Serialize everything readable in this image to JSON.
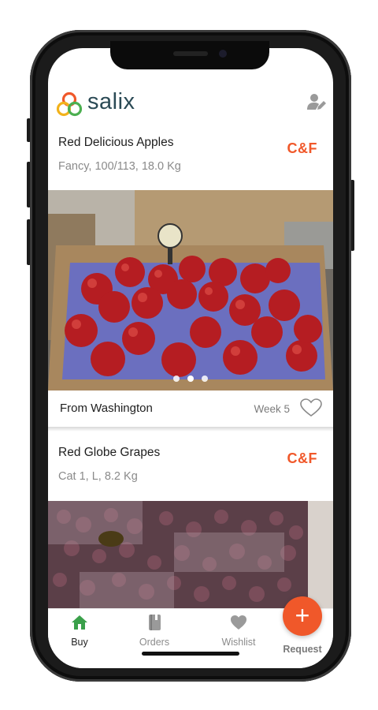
{
  "app": {
    "brand": "salix"
  },
  "colors": {
    "accent": "#f0582a",
    "brand_text": "#2b4a55",
    "active_tab": "#3aa04a"
  },
  "products": [
    {
      "title": "Red Delicious Apples",
      "details": "Fancy, 100/113, 18.0 Kg",
      "badge": "C&F",
      "origin": "From Washington",
      "week": "Week 5",
      "photo_icon": "apples-photo",
      "carousel": {
        "count": 3,
        "active": 1
      }
    },
    {
      "title": "Red Globe Grapes",
      "details": "Cat 1, L, 8.2 Kg",
      "badge": "C&F",
      "photo_icon": "grapes-photo"
    }
  ],
  "tabs": [
    {
      "label": "Buy",
      "icon": "home-icon",
      "active": true
    },
    {
      "label": "Orders",
      "icon": "book-icon",
      "active": false
    },
    {
      "label": "Wishlist",
      "icon": "heart-icon",
      "active": false
    },
    {
      "label": "Request",
      "icon": "plus-icon",
      "active": false
    }
  ],
  "fab": {
    "symbol": "+"
  }
}
